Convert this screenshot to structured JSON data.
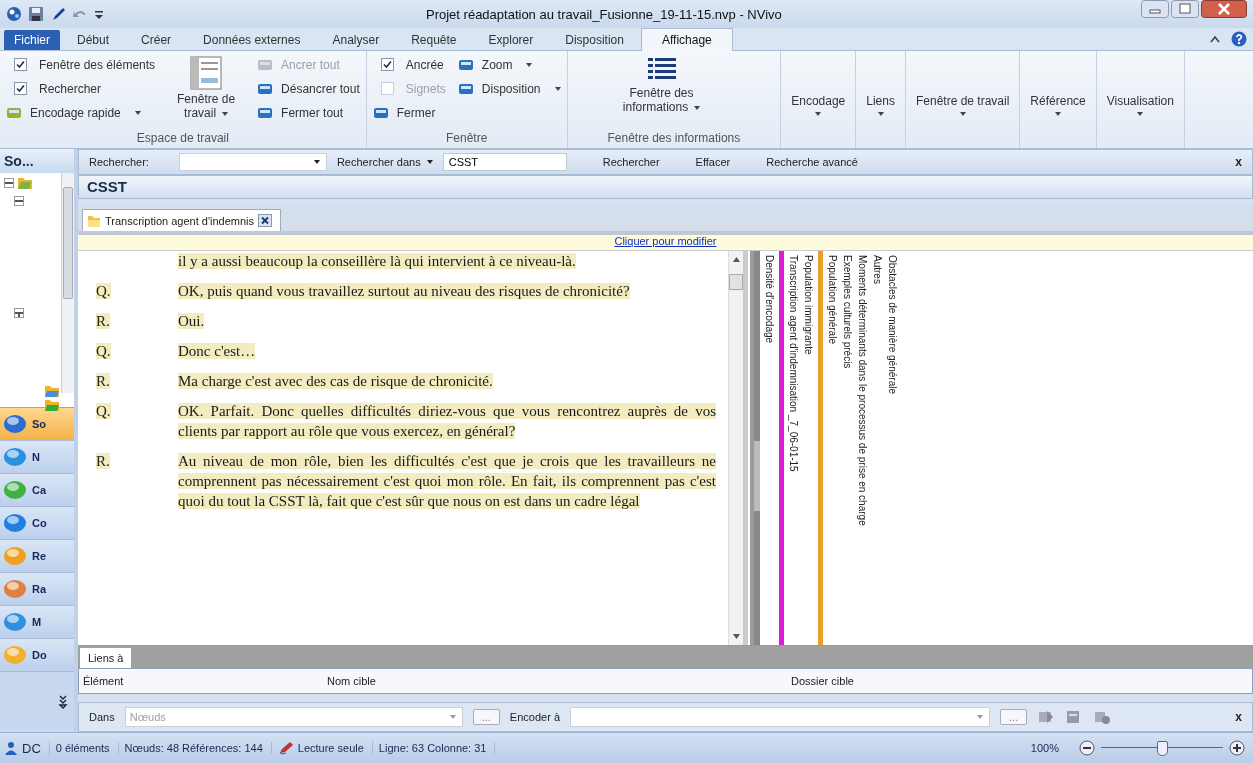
{
  "window": {
    "title": "Projet réadaptation au travail_Fusionne_19-11-15.nvp - NVivo"
  },
  "ribbon_tabs": [
    {
      "label": "Fichier",
      "kind": "file",
      "selected": false
    },
    {
      "label": "Début",
      "kind": "tab",
      "selected": false
    },
    {
      "label": "Créer",
      "kind": "tab",
      "selected": false
    },
    {
      "label": "Données externes",
      "kind": "tab",
      "selected": false
    },
    {
      "label": "Analyser",
      "kind": "tab",
      "selected": false
    },
    {
      "label": "Requête",
      "kind": "tab",
      "selected": false
    },
    {
      "label": "Explorer",
      "kind": "tab",
      "selected": false
    },
    {
      "label": "Disposition",
      "kind": "tab",
      "selected": false
    },
    {
      "label": "Affichage",
      "kind": "tab",
      "selected": true
    }
  ],
  "ribbon_groups": [
    {
      "label": "Espace de travail",
      "columns": [
        [
          {
            "kind": "check",
            "label": "Fenêtre des éléments",
            "checked": true,
            "disabled": false
          },
          {
            "kind": "check",
            "label": "Rechercher",
            "checked": true,
            "disabled": false
          },
          {
            "kind": "command",
            "label": "Encodage rapide",
            "disabled": false,
            "dropdown": true
          }
        ],
        [
          {
            "kind": "large",
            "label": "Fenêtre de travail",
            "disabled": false,
            "dropdown": true
          }
        ],
        [
          {
            "kind": "command",
            "label": "Ancrer tout",
            "disabled": true,
            "dropdown": false
          },
          {
            "kind": "command",
            "label": "Désancrer tout",
            "disabled": false,
            "dropdown": false
          },
          {
            "kind": "command",
            "label": "Fermer tout",
            "disabled": false,
            "dropdown": false
          }
        ]
      ]
    },
    {
      "label": "Fenêtre",
      "columns": [
        [
          {
            "kind": "check",
            "label": "Ancrée",
            "checked": true,
            "disabled": false
          },
          {
            "kind": "check",
            "label": "Signets",
            "checked": false,
            "disabled": true
          },
          {
            "kind": "command",
            "label": "Fermer",
            "disabled": false,
            "dropdown": false
          }
        ],
        [
          {
            "kind": "command",
            "label": "Zoom",
            "disabled": false,
            "dropdown": true
          },
          {
            "kind": "command",
            "label": "Disposition",
            "disabled": false,
            "dropdown": true
          }
        ]
      ]
    },
    {
      "label": "Fenêtre des informations",
      "columns": [
        [
          {
            "kind": "large",
            "label": "Fenêtre des informations",
            "disabled": false,
            "dropdown": true
          }
        ]
      ]
    },
    {
      "columns": [
        [
          {
            "kind": "menu",
            "label": "Encodage",
            "disabled": false,
            "dropdown": true
          }
        ]
      ]
    },
    {
      "columns": [
        [
          {
            "kind": "menu",
            "label": "Liens",
            "disabled": false,
            "dropdown": true
          }
        ]
      ]
    },
    {
      "columns": [
        [
          {
            "kind": "menu",
            "label": "Fenêtre de travail",
            "disabled": false,
            "dropdown": true
          }
        ]
      ]
    },
    {
      "columns": [
        [
          {
            "kind": "menu",
            "label": "Référence",
            "disabled": false,
            "dropdown": true
          }
        ]
      ]
    },
    {
      "columns": [
        [
          {
            "kind": "menu",
            "label": "Visualisation",
            "disabled": false,
            "dropdown": true
          }
        ]
      ]
    }
  ],
  "search_bar": {
    "label": "Rechercher:",
    "scope_label": "Rechercher dans",
    "value": "CSST",
    "buttons": [
      "Rechercher",
      "Effacer",
      "Recherche avancé"
    ],
    "close": "x"
  },
  "sidebar": {
    "title": "So...",
    "nav": [
      {
        "label": "So",
        "selected": true
      },
      {
        "label": "N",
        "selected": false
      },
      {
        "label": "Ca",
        "selected": false
      },
      {
        "label": "Co",
        "selected": false
      },
      {
        "label": "Re",
        "selected": false
      },
      {
        "label": "Ra",
        "selected": false
      },
      {
        "label": "M",
        "selected": false
      },
      {
        "label": "Do",
        "selected": false
      }
    ]
  },
  "document": {
    "title": "CSST",
    "tabs": [
      {
        "label": "Transcription agent d'indemnis",
        "selected": true
      }
    ],
    "edit_hint": "Cliquer pour modifier",
    "paragraphs": [
      {
        "text": "il y a aussi beaucoup la conseillère là qui intervient à ce niveau-là."
      },
      {
        "speaker": "Q.",
        "text": "OK, puis quand vous travaillez surtout au niveau des risques de chronicité?"
      },
      {
        "speaker": "R.",
        "text": "Oui."
      },
      {
        "speaker": "Q.",
        "text": "Donc c'est…"
      },
      {
        "speaker": "R.",
        "text": "Ma charge c'est avec des cas de risque de chronicité."
      },
      {
        "speaker": "Q.",
        "text": "OK. Parfait.  Donc quelles difficultés diriez-vous que vous rencontrez auprès de vos clients par rapport au rôle que vous exercez, en général?"
      },
      {
        "speaker": "R.",
        "text": "Au niveau de mon rôle, bien les difficultés c'est que je crois que les travailleurs ne comprennent pas nécessairement c'est quoi mon rôle.  En fait, ils comprennent pas c'est quoi du tout la CSST là, fait que c'est sûr que nous on est dans un cadre légal"
      }
    ],
    "coding_stripes": [
      {
        "kind": "density",
        "label": "Densité d'encodage"
      },
      {
        "kind": "stripe",
        "label": "Transcription agent d'indemnisation _7_06-01-15",
        "color": "#e01ad8"
      },
      {
        "kind": "label",
        "label": "Population immigrante"
      },
      {
        "kind": "stripe",
        "label": "Population générale",
        "color": "#e8a028"
      },
      {
        "kind": "label",
        "label": "Exemples culturels précis"
      },
      {
        "kind": "label",
        "label": "Moments déterminants dans le processus de prise en charge"
      },
      {
        "kind": "label",
        "label": "Autres"
      },
      {
        "kind": "label",
        "label": "Obstacles de manière générale"
      }
    ]
  },
  "links": {
    "tabs": [
      {
        "label": "Liens à",
        "selected": true
      }
    ],
    "columns": [
      "Élément",
      "Nom cible",
      "Dossier cible"
    ]
  },
  "code_bar": {
    "in_label": "Dans",
    "in_placeholder": "Nœuds",
    "browse": "...",
    "to_label": "Encoder à",
    "browse_to": "...",
    "close": "x"
  },
  "status_bar": {
    "user": "DC",
    "items": "0 éléments",
    "counts": "Nœuds: 48 Références: 144",
    "mode": "Lecture seule",
    "position": "Ligne: 63 Colonne: 31",
    "zoom": "100%",
    "zoom_slider": {
      "level": 0.5
    }
  }
}
